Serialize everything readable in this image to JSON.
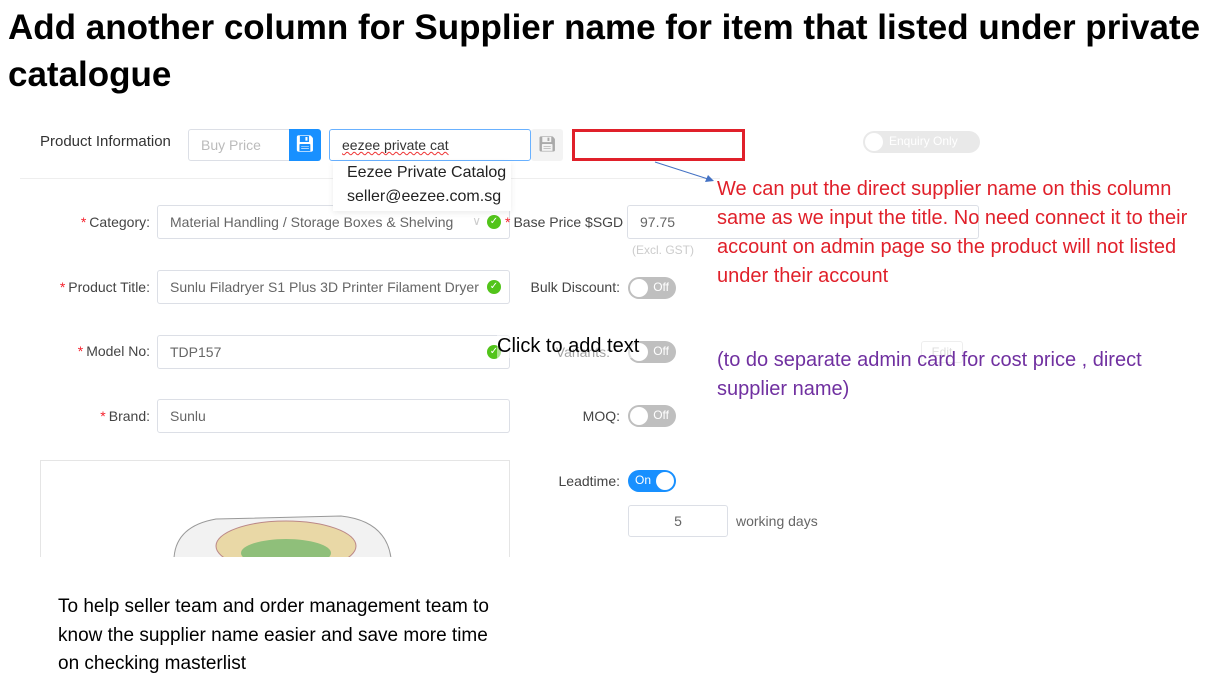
{
  "slide": {
    "title": "Add another column for Supplier name for item that listed under private catalogue",
    "note_red": "We can put the direct supplier name on this column same as we input the title. No need connect it to their account on admin page so the product will not listed under their account",
    "note_purple": "(to do separate admin card for cost price , direct supplier name)",
    "note_bottom": "To help seller team and order management team to know the supplier name easier and save more time on checking masterlist",
    "placeholder_text": "Click to add text",
    "colors": {
      "red": "#e0202a",
      "purple": "#7030a0",
      "accent": "#1890ff",
      "success": "#52c41a"
    }
  },
  "header": {
    "section_label": "Product Information",
    "buy_price_placeholder": "Buy Price",
    "catalog_input_value": "eezee private cat",
    "supplier_name_value": "",
    "enquiry_toggle_label": "Enquiry Only",
    "enquiry_on": false,
    "dropdown": [
      "Eezee Private Catalog",
      "seller@eezee.com.sg"
    ]
  },
  "form": {
    "category": {
      "label": "Category",
      "value": "Material Handling / Storage Boxes & Shelving"
    },
    "title": {
      "label": "Product Title",
      "value": "Sunlu Filadryer S1 Plus 3D Printer Filament Dryer"
    },
    "model": {
      "label": "Model No",
      "value": "TDP157"
    },
    "brand": {
      "label": "Brand",
      "value": "Sunlu"
    },
    "base_price": {
      "label": "Base Price $SGD",
      "value": "97.75",
      "hint": "(Excl. GST)"
    },
    "bulk_discount": {
      "label": "Bulk Discount",
      "state": "Off"
    },
    "variants": {
      "label": "Variants",
      "state": "Off",
      "edit_label": "Edit"
    },
    "moq": {
      "label": "MOQ",
      "state": "Off"
    },
    "leadtime": {
      "label": "Leadtime",
      "state": "On",
      "days": "5",
      "unit": "working days"
    }
  }
}
